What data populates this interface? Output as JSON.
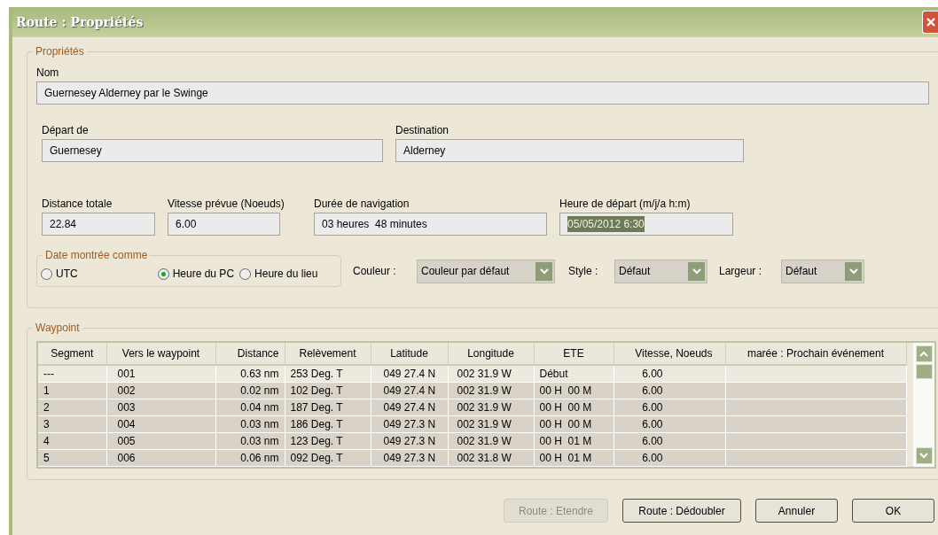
{
  "window": {
    "title": "Route : Propriétés"
  },
  "properties": {
    "legend": "Propriétés",
    "name": {
      "label": "Nom",
      "value": "Guernesey Alderney par le Swinge"
    },
    "departure": {
      "label": "Départ de",
      "value": "Guernesey"
    },
    "destination": {
      "label": "Destination",
      "value": "Alderney"
    },
    "total_distance": {
      "label": "Distance totale",
      "value": "22.84"
    },
    "planned_speed": {
      "label": "Vitesse prévue (Noeuds)",
      "value": "6.00"
    },
    "duration": {
      "label": "Durée de navigation",
      "value": "03 heures  48 minutes"
    },
    "departure_time": {
      "label": "Heure de départ (m/j/a h:m)",
      "value": "05/05/2012 6:30",
      "text_selected": true
    },
    "date_shown_as": {
      "legend": "Date montrée comme",
      "options": [
        {
          "label": "UTC",
          "selected": false
        },
        {
          "label": "Heure du PC",
          "selected": true
        },
        {
          "label": "Heure du lieu",
          "selected": false
        }
      ]
    },
    "color": {
      "label": "Couleur :",
      "value": "Couleur par défaut"
    },
    "style": {
      "label": "Style :",
      "value": "Défaut"
    },
    "width": {
      "label": "Largeur :",
      "value": "Défaut"
    }
  },
  "waypoints": {
    "legend": "Waypoint",
    "columns": [
      "Segment",
      "Vers le waypoint",
      "Distance",
      "Relèvement",
      "Latitude",
      "Longitude",
      "ETE",
      "Vitesse, Noeuds",
      "marée : Prochain événement"
    ],
    "rows": [
      {
        "selected": false,
        "cells": [
          "---",
          "001",
          "0.63 nm",
          "253 Deg. T",
          "049 27.4 N",
          "002 31.9 W",
          "Début",
          "6.00",
          ""
        ]
      },
      {
        "selected": true,
        "cells": [
          "1",
          "002",
          "0.02 nm",
          "102 Deg. T",
          "049 27.4 N",
          "002 31.9 W",
          "00 H  00 M",
          "6.00",
          ""
        ]
      },
      {
        "selected": true,
        "cells": [
          "2",
          "003",
          "0.04 nm",
          "187 Deg. T",
          "049 27.4 N",
          "002 31.9 W",
          "00 H  00 M",
          "6.00",
          ""
        ]
      },
      {
        "selected": true,
        "cells": [
          "3",
          "004",
          "0.03 nm",
          "186 Deg. T",
          "049 27.3 N",
          "002 31.9 W",
          "00 H  00 M",
          "6.00",
          ""
        ]
      },
      {
        "selected": true,
        "cells": [
          "4",
          "005",
          "0.03 nm",
          "123 Deg. T",
          "049 27.3 N",
          "002 31.9 W",
          "00 H  01 M",
          "6.00",
          ""
        ]
      },
      {
        "selected": true,
        "cells": [
          "5",
          "006",
          "0.06 nm",
          "092 Deg. T",
          "049 27.3 N",
          "002 31.8 W",
          "00 H  01 M",
          "6.00",
          ""
        ]
      }
    ]
  },
  "buttons": [
    {
      "label": "Route : Etendre",
      "disabled": true
    },
    {
      "label": "Route : Dédoubler",
      "disabled": false
    },
    {
      "label": "Annuler",
      "disabled": false
    },
    {
      "label": "OK",
      "disabled": false
    }
  ]
}
